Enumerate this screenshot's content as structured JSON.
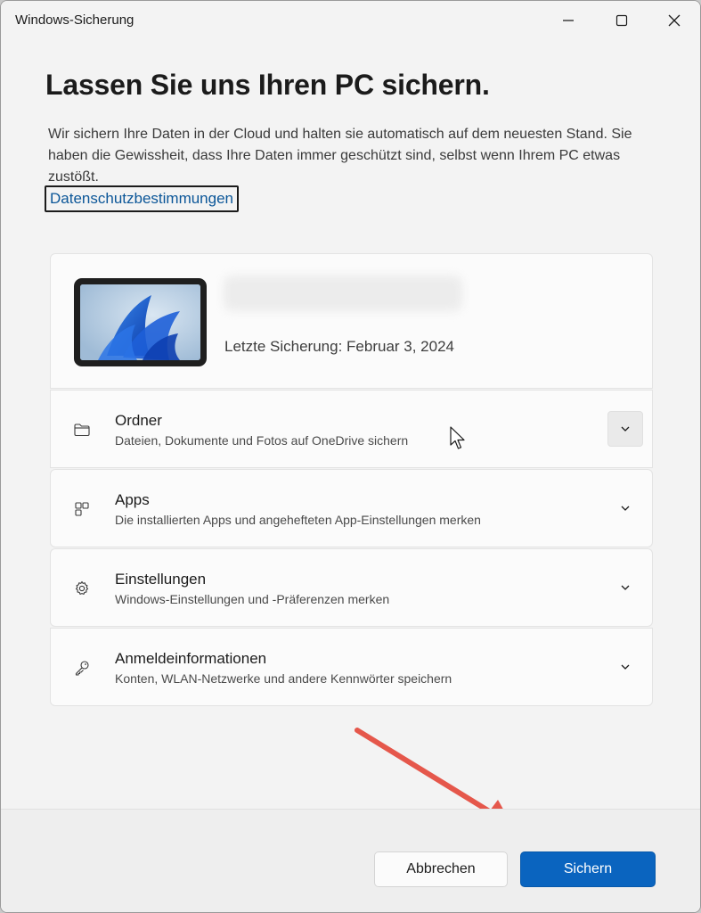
{
  "window": {
    "title": "Windows-Sicherung"
  },
  "main": {
    "heading": "Lassen Sie uns Ihren PC sichern.",
    "description": "Wir sichern Ihre Daten in der Cloud und halten sie automatisch auf dem neuesten Stand. Sie haben die Gewissheit, dass Ihre Daten immer geschützt sind, selbst wenn Ihrem PC etwas zustößt.",
    "privacy_link": "Datenschutzbestimmungen"
  },
  "device": {
    "last_backup": "Letzte Sicherung: Februar 3, 2024"
  },
  "options": [
    {
      "title": "Ordner",
      "subtitle": "Dateien, Dokumente und Fotos auf OneDrive sichern",
      "icon": "folder-icon"
    },
    {
      "title": "Apps",
      "subtitle": "Die installierten Apps und angehefteten App-Einstellungen merken",
      "icon": "apps-icon"
    },
    {
      "title": "Einstellungen",
      "subtitle": "Windows-Einstellungen und -Präferenzen merken",
      "icon": "gear-icon"
    },
    {
      "title": "Anmeldeinformationen",
      "subtitle": "Konten, WLAN-Netzwerke und andere Kennwörter speichern",
      "icon": "key-icon"
    }
  ],
  "footer": {
    "cancel_label": "Abbrechen",
    "primary_label": "Sichern"
  },
  "colors": {
    "accent": "#0a64bf",
    "link": "#0b5698",
    "annotation_arrow": "#e5574b"
  }
}
